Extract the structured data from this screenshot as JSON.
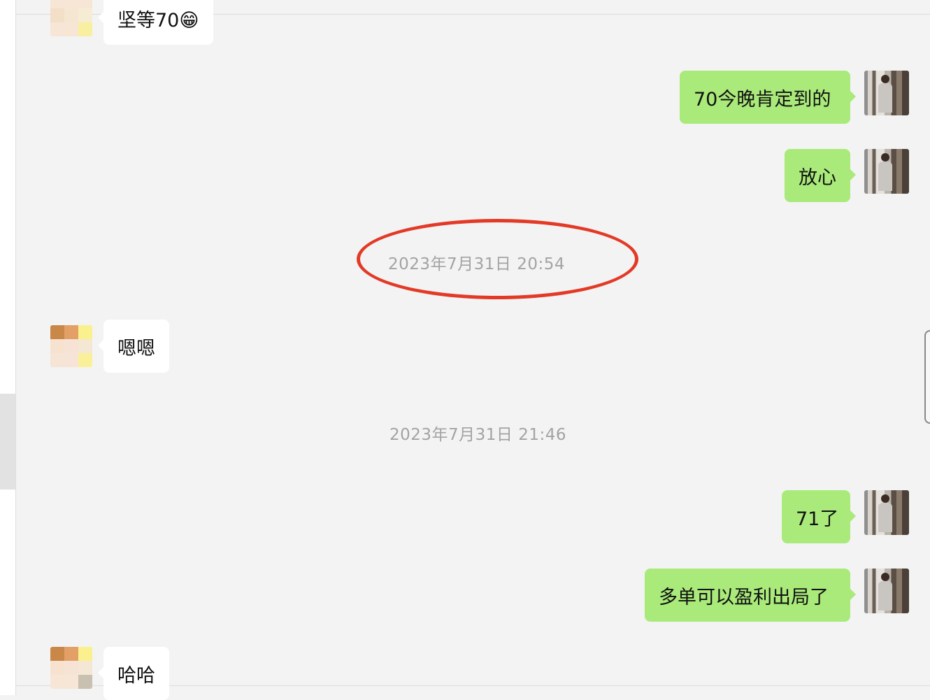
{
  "messages": [
    {
      "side": "in",
      "text": "坚等70😁"
    },
    {
      "side": "out",
      "text": "70今晚肯定到的"
    },
    {
      "side": "out",
      "text": "放心"
    },
    {
      "side": "in",
      "text": "嗯嗯"
    },
    {
      "side": "out",
      "text": "71了"
    },
    {
      "side": "out",
      "text": "多单可以盈利出局了"
    },
    {
      "side": "in",
      "text": "哈哈"
    }
  ],
  "timestamps": [
    "2023年7月31日 20:54",
    "2023年7月31日 21:46"
  ],
  "colors": {
    "outgoing_bubble": "#a9ea7a",
    "incoming_bubble": "#ffffff",
    "background": "#f3f3f3",
    "timestamp_text": "#a3a3a3",
    "highlight_circle": "#e33a27"
  }
}
